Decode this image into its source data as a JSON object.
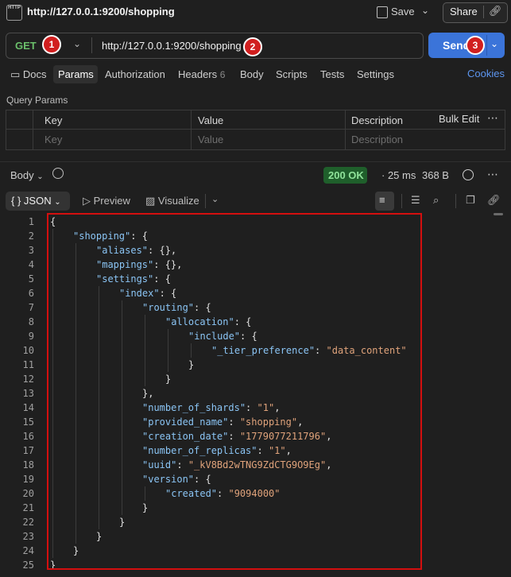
{
  "window": {
    "app_badge": "HTTP",
    "title": "http://127.0.0.1:9200/shopping",
    "save_label": "Save",
    "share_label": "Share"
  },
  "request": {
    "method": "GET",
    "url": "http://127.0.0.1:9200/shopping",
    "send_label": "Send"
  },
  "markers": [
    "1",
    "2",
    "3"
  ],
  "tabs": [
    {
      "label": "Docs"
    },
    {
      "label": "Params",
      "active": true
    },
    {
      "label": "Authorization"
    },
    {
      "label": "Headers",
      "count": "6"
    },
    {
      "label": "Body"
    },
    {
      "label": "Scripts"
    },
    {
      "label": "Tests"
    },
    {
      "label": "Settings"
    }
  ],
  "cookies_label": "Cookies",
  "query_params": {
    "title": "Query Params",
    "headers": [
      "Key",
      "Value",
      "Description"
    ],
    "bulk_edit": "Bulk Edit",
    "placeholders": [
      "Key",
      "Value",
      "Description"
    ]
  },
  "response": {
    "body_label": "Body",
    "status": "200 OK",
    "status_color": "#8fe39a",
    "time": "25 ms",
    "size": "368 B",
    "view_json": "JSON",
    "view_preview": "Preview",
    "view_visualize": "Visualize"
  },
  "icons": [
    "http-icon",
    "save-icon",
    "link-icon",
    "chevron-down-icon",
    "history-icon",
    "globe-icon",
    "more-icon",
    "wrap-icon",
    "filter-icon",
    "search-icon",
    "copy-icon",
    "link-icon"
  ],
  "highlight_color": "#d40f0f",
  "code_lines": [
    {
      "n": "1",
      "indent": 0,
      "parts": [
        [
          "p",
          "{"
        ]
      ]
    },
    {
      "n": "2",
      "indent": 1,
      "parts": [
        [
          "k",
          "\"shopping\""
        ],
        [
          "p",
          ": {"
        ]
      ]
    },
    {
      "n": "3",
      "indent": 2,
      "parts": [
        [
          "k",
          "\"aliases\""
        ],
        [
          "p",
          ": {},"
        ]
      ]
    },
    {
      "n": "4",
      "indent": 2,
      "parts": [
        [
          "k",
          "\"mappings\""
        ],
        [
          "p",
          ": {},"
        ]
      ]
    },
    {
      "n": "5",
      "indent": 2,
      "parts": [
        [
          "k",
          "\"settings\""
        ],
        [
          "p",
          ": {"
        ]
      ]
    },
    {
      "n": "6",
      "indent": 3,
      "parts": [
        [
          "k",
          "\"index\""
        ],
        [
          "p",
          ": {"
        ]
      ]
    },
    {
      "n": "7",
      "indent": 4,
      "parts": [
        [
          "k",
          "\"routing\""
        ],
        [
          "p",
          ": {"
        ]
      ]
    },
    {
      "n": "8",
      "indent": 5,
      "parts": [
        [
          "k",
          "\"allocation\""
        ],
        [
          "p",
          ": {"
        ]
      ]
    },
    {
      "n": "9",
      "indent": 6,
      "parts": [
        [
          "k",
          "\"include\""
        ],
        [
          "p",
          ": {"
        ]
      ]
    },
    {
      "n": "10",
      "indent": 7,
      "parts": [
        [
          "k",
          "\"_tier_preference\""
        ],
        [
          "p",
          ": "
        ],
        [
          "s",
          "\"data_content\""
        ]
      ]
    },
    {
      "n": "11",
      "indent": 6,
      "parts": [
        [
          "p",
          "}"
        ]
      ]
    },
    {
      "n": "12",
      "indent": 5,
      "parts": [
        [
          "p",
          "}"
        ]
      ]
    },
    {
      "n": "13",
      "indent": 4,
      "parts": [
        [
          "p",
          "},"
        ]
      ]
    },
    {
      "n": "14",
      "indent": 4,
      "parts": [
        [
          "k",
          "\"number_of_shards\""
        ],
        [
          "p",
          ": "
        ],
        [
          "s",
          "\"1\""
        ],
        [
          "p",
          ","
        ]
      ]
    },
    {
      "n": "15",
      "indent": 4,
      "parts": [
        [
          "k",
          "\"provided_name\""
        ],
        [
          "p",
          ": "
        ],
        [
          "s",
          "\"shopping\""
        ],
        [
          "p",
          ","
        ]
      ]
    },
    {
      "n": "16",
      "indent": 4,
      "parts": [
        [
          "k",
          "\"creation_date\""
        ],
        [
          "p",
          ": "
        ],
        [
          "s",
          "\"1779077211796\""
        ],
        [
          "p",
          ","
        ]
      ]
    },
    {
      "n": "17",
      "indent": 4,
      "parts": [
        [
          "k",
          "\"number_of_replicas\""
        ],
        [
          "p",
          ": "
        ],
        [
          "s",
          "\"1\""
        ],
        [
          "p",
          ","
        ]
      ]
    },
    {
      "n": "18",
      "indent": 4,
      "parts": [
        [
          "k",
          "\"uuid\""
        ],
        [
          "p",
          ": "
        ],
        [
          "s",
          "\"_kV8Bd2wTNG9ZdCTG9O9Eg\""
        ],
        [
          "p",
          ","
        ]
      ]
    },
    {
      "n": "19",
      "indent": 4,
      "parts": [
        [
          "k",
          "\"version\""
        ],
        [
          "p",
          ": {"
        ]
      ]
    },
    {
      "n": "20",
      "indent": 5,
      "parts": [
        [
          "k",
          "\"created\""
        ],
        [
          "p",
          ": "
        ],
        [
          "s",
          "\"9094000\""
        ]
      ]
    },
    {
      "n": "21",
      "indent": 4,
      "parts": [
        [
          "p",
          "}"
        ]
      ]
    },
    {
      "n": "22",
      "indent": 3,
      "parts": [
        [
          "p",
          "}"
        ]
      ]
    },
    {
      "n": "23",
      "indent": 2,
      "parts": [
        [
          "p",
          "}"
        ]
      ]
    },
    {
      "n": "24",
      "indent": 1,
      "parts": [
        [
          "p",
          "}"
        ]
      ]
    },
    {
      "n": "25",
      "indent": 0,
      "parts": [
        [
          "p",
          "}"
        ]
      ]
    }
  ]
}
